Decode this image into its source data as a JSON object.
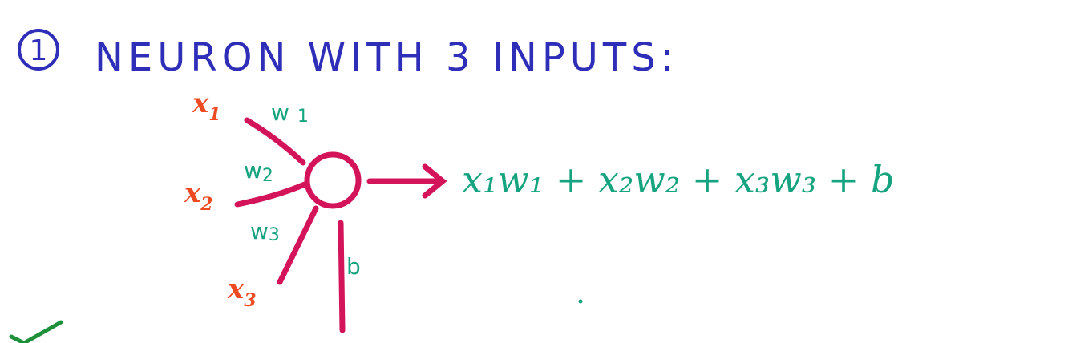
{
  "title": {
    "number": "1",
    "text": "NEURON WITH 3 INPUTS:"
  },
  "inputs": [
    {
      "var": "x",
      "sub": "1"
    },
    {
      "var": "x",
      "sub": "2"
    },
    {
      "var": "x",
      "sub": "3"
    }
  ],
  "weights": [
    {
      "var": "w",
      "sub": "1"
    },
    {
      "var": "w",
      "sub": "2"
    },
    {
      "var": "w",
      "sub": "3"
    }
  ],
  "bias": "b",
  "formula": "x₁w₁ + x₂w₂ + x₃w₃ + b",
  "colors": {
    "title": "#2e2eb8",
    "edges": "#d4145a",
    "inputs": "#ee4a22",
    "weights": "#16a37f",
    "formula": "#16a37f",
    "check": "#1e8f3a"
  }
}
